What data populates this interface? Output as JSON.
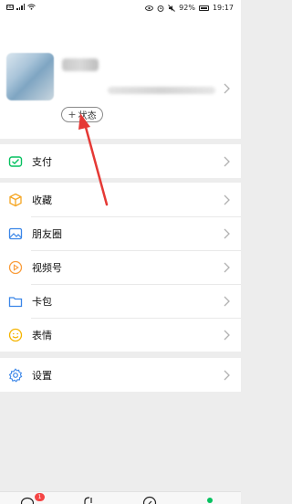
{
  "status_bar": {
    "battery": "92%",
    "time": "19:17",
    "carrier_icon": "HD"
  },
  "profile": {
    "status_button_label": "状态",
    "status_button_icon": "plus-icon"
  },
  "menu": {
    "pay": {
      "label": "支付",
      "icon": "wallet-icon",
      "color": "#07c160"
    },
    "favorites": {
      "label": "收藏",
      "icon": "cube-icon",
      "color": "#f5a623"
    },
    "moments": {
      "label": "朋友圈",
      "icon": "image-icon",
      "color": "#3b86e8"
    },
    "channels": {
      "label": "视频号",
      "icon": "play-icon",
      "color": "#fa9d3b"
    },
    "cards": {
      "label": "卡包",
      "icon": "card-icon",
      "color": "#3b86e8"
    },
    "stickers": {
      "label": "表情",
      "icon": "smile-icon",
      "color": "#f5b400"
    },
    "settings": {
      "label": "设置",
      "icon": "gear-icon",
      "color": "#3b86e8"
    }
  },
  "tab_bar": {
    "chats_badge": "1",
    "active_color": "#07c160"
  },
  "annotation_arrow_color": "#e53935"
}
